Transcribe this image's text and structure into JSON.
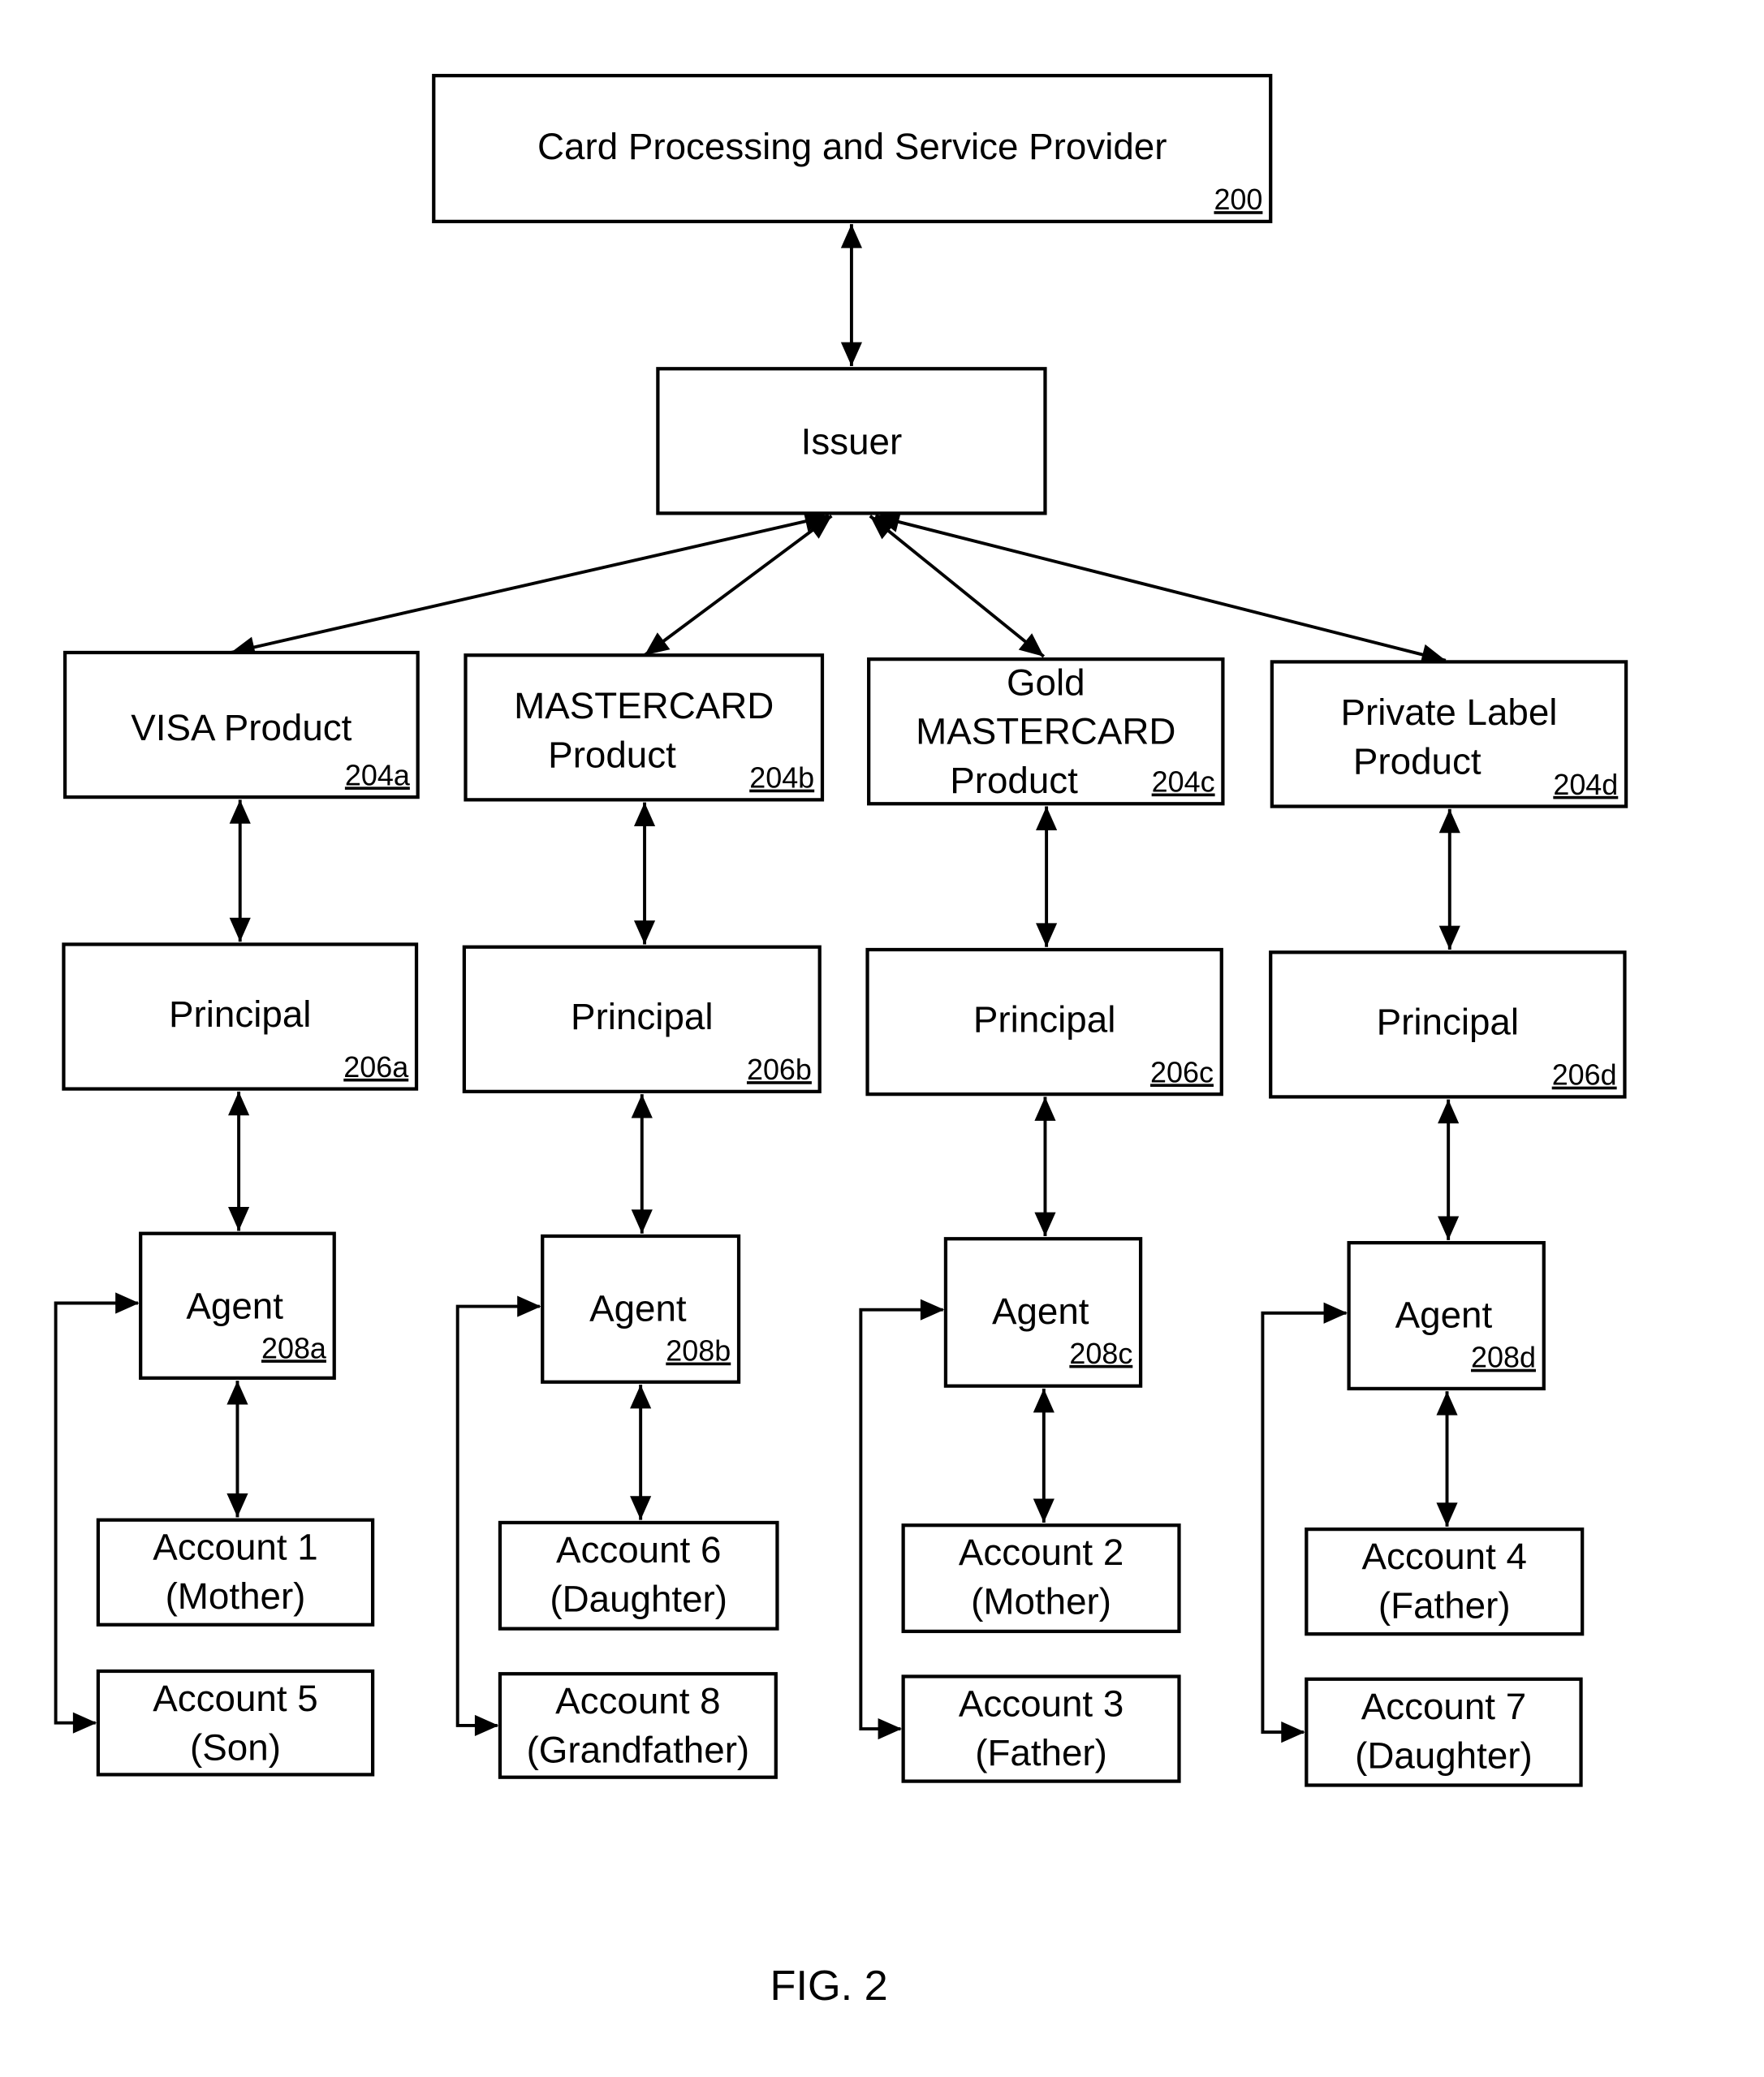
{
  "figure": {
    "caption": "FIG. 2",
    "colors": {
      "stroke": "#000000",
      "background": "#ffffff"
    }
  },
  "nodes": {
    "provider": {
      "lines": [
        "Card Processing and Service Provider"
      ],
      "ref": "200"
    },
    "issuer": {
      "lines": [
        "Issuer"
      ],
      "ref": ""
    },
    "products": [
      {
        "lines": [
          "VISA Product"
        ],
        "ref": "204a"
      },
      {
        "lines": [
          "MASTERCARD",
          "Product"
        ],
        "ref": "204b"
      },
      {
        "lines": [
          "Gold",
          "MASTERCARD",
          "Product"
        ],
        "ref": "204c"
      },
      {
        "lines": [
          "Private Label",
          "Product"
        ],
        "ref": "204d"
      }
    ],
    "principals": [
      {
        "lines": [
          "Principal"
        ],
        "ref": "206a"
      },
      {
        "lines": [
          "Principal"
        ],
        "ref": "206b"
      },
      {
        "lines": [
          "Principal"
        ],
        "ref": "206c"
      },
      {
        "lines": [
          "Principal"
        ],
        "ref": "206d"
      }
    ],
    "agents": [
      {
        "lines": [
          "Agent"
        ],
        "ref": "208a"
      },
      {
        "lines": [
          "Agent"
        ],
        "ref": "208b"
      },
      {
        "lines": [
          "Agent"
        ],
        "ref": "208c"
      },
      {
        "lines": [
          "Agent"
        ],
        "ref": "208d"
      }
    ],
    "accounts_primary": [
      {
        "lines": [
          "Account 1",
          "(Mother)"
        ]
      },
      {
        "lines": [
          "Account 6",
          "(Daughter)"
        ]
      },
      {
        "lines": [
          "Account 2",
          "(Mother)"
        ]
      },
      {
        "lines": [
          "Account 4",
          "(Father)"
        ]
      }
    ],
    "accounts_secondary": [
      {
        "lines": [
          "Account 5",
          "(Son)"
        ]
      },
      {
        "lines": [
          "Account 8",
          "(Grandfather)"
        ]
      },
      {
        "lines": [
          "Account 3",
          "(Father)"
        ]
      },
      {
        "lines": [
          "Account 7",
          "(Daughter)"
        ]
      }
    ]
  },
  "edges": [
    {
      "from": "provider",
      "to": "issuer",
      "type": "bidirectional"
    },
    {
      "from": "issuer",
      "to": "products.0",
      "type": "bidirectional"
    },
    {
      "from": "issuer",
      "to": "products.1",
      "type": "bidirectional"
    },
    {
      "from": "issuer",
      "to": "products.2",
      "type": "bidirectional"
    },
    {
      "from": "issuer",
      "to": "products.3",
      "type": "bidirectional"
    },
    {
      "from": "products.0",
      "to": "principals.0",
      "type": "bidirectional"
    },
    {
      "from": "products.1",
      "to": "principals.1",
      "type": "bidirectional"
    },
    {
      "from": "products.2",
      "to": "principals.2",
      "type": "bidirectional"
    },
    {
      "from": "products.3",
      "to": "principals.3",
      "type": "bidirectional"
    },
    {
      "from": "principals.0",
      "to": "agents.0",
      "type": "bidirectional"
    },
    {
      "from": "principals.1",
      "to": "agents.1",
      "type": "bidirectional"
    },
    {
      "from": "principals.2",
      "to": "agents.2",
      "type": "bidirectional"
    },
    {
      "from": "principals.3",
      "to": "agents.3",
      "type": "bidirectional"
    },
    {
      "from": "agents.0",
      "to": "accounts_primary.0",
      "type": "bidirectional"
    },
    {
      "from": "agents.1",
      "to": "accounts_primary.1",
      "type": "bidirectional"
    },
    {
      "from": "agents.2",
      "to": "accounts_primary.2",
      "type": "bidirectional"
    },
    {
      "from": "agents.3",
      "to": "accounts_primary.3",
      "type": "bidirectional"
    },
    {
      "from": "agents.0",
      "to": "accounts_secondary.0",
      "type": "loop-bidirectional"
    },
    {
      "from": "agents.1",
      "to": "accounts_secondary.1",
      "type": "loop-bidirectional"
    },
    {
      "from": "agents.2",
      "to": "accounts_secondary.2",
      "type": "loop-bidirectional"
    },
    {
      "from": "agents.3",
      "to": "accounts_secondary.3",
      "type": "loop-bidirectional"
    }
  ]
}
